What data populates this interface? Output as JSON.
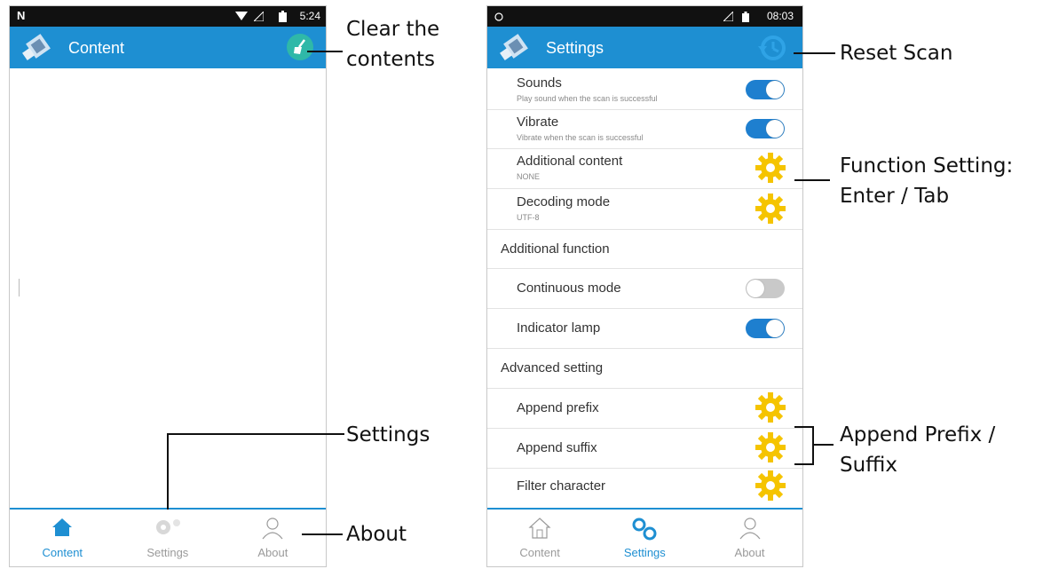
{
  "content_screen": {
    "status_time": "5:24",
    "title": "Content",
    "tabs": [
      {
        "label": "Content",
        "active": true
      },
      {
        "label": "Settings",
        "active": false
      },
      {
        "label": "About",
        "active": false
      }
    ]
  },
  "settings_screen": {
    "status_time": "08:03",
    "title": "Settings",
    "items": [
      {
        "title": "Sounds",
        "subtitle": "Play sound when the scan is successful",
        "control": "toggle-on"
      },
      {
        "title": "Vibrate",
        "subtitle": "Vibrate when the scan is successful",
        "control": "toggle-on"
      },
      {
        "title": "Additional content",
        "subtitle": "NONE",
        "control": "gear"
      },
      {
        "title": "Decoding mode",
        "subtitle": "UTF-8",
        "control": "gear"
      }
    ],
    "section_additional": "Additional function",
    "continuous_mode": {
      "title": "Continuous mode",
      "on": false
    },
    "indicator_lamp": {
      "title": "Indicator lamp",
      "on": true
    },
    "section_advanced": "Advanced setting",
    "append_prefix": "Append prefix",
    "append_suffix": "Append suffix",
    "filter_character": "Filter character",
    "tabs": [
      {
        "label": "Content",
        "active": false
      },
      {
        "label": "Settings",
        "active": true
      },
      {
        "label": "About",
        "active": false
      }
    ]
  },
  "callouts": {
    "clear_line1": "Clear the",
    "clear_line2": "contents",
    "settings": "Settings",
    "about": "About",
    "reset_scan": "Reset Scan",
    "function_line1": "Function Setting:",
    "function_line2": "Enter / Tab",
    "append_line1": "Append Prefix /",
    "append_line2": "Suffix"
  },
  "colors": {
    "accent": "#1e8fd2",
    "gear": "#f5c400",
    "statusbar": "#111111"
  },
  "icons": [
    "app-logo-icon",
    "broom-icon",
    "reset-scan-icon",
    "home-icon",
    "settings-gear-icon",
    "about-person-icon",
    "wifi-icon",
    "battery-icon"
  ]
}
